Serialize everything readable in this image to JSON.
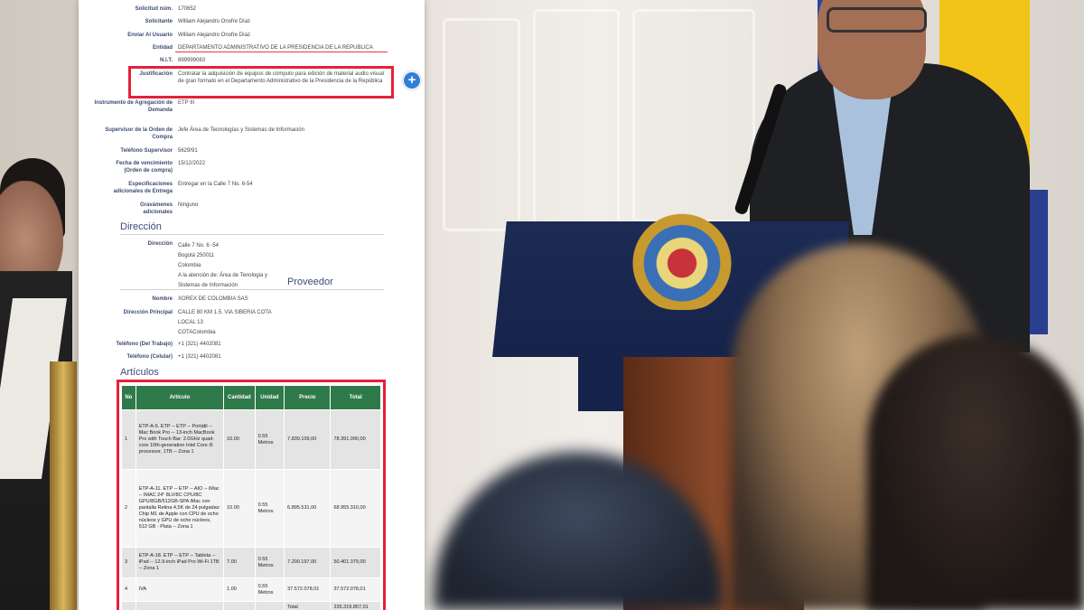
{
  "document": {
    "fields": [
      {
        "label": "Solicitud núm.",
        "value": "170652"
      },
      {
        "label": "Solicitante",
        "value": "William Alejandro Onofre Díaz"
      },
      {
        "label": "Enviar Al Usuario",
        "value": "William Alejandro Onofre Díaz"
      },
      {
        "label": "Entidad",
        "value": "DEPARTAMENTO ADMINISTRATIVO DE LA PRESIDENCIA DE LA REPUBLICA"
      },
      {
        "label": "N.I.T.",
        "value": "899999083"
      },
      {
        "label": "Justificación",
        "value": "Contratar la adquisición de equipos de cómputo para edición de material audio visual de gran formato en el Departamento Administrativo de la Presidencia de la República"
      },
      {
        "label": "Instrumento de Agregación de Demanda",
        "value": "ETP III"
      },
      {
        "label": "Supervisor de la Orden de Compra",
        "value": "Jefe Área de Tecnologías y Sistemas de Información"
      },
      {
        "label": "Teléfono Supervisor",
        "value": "5629/91"
      },
      {
        "label": "Fecha de vencimiento (Orden de compra)",
        "value": "15/12/2022"
      },
      {
        "label": "Especificaciones adicionales de Entrega",
        "value": "Entregar en la Calle 7 No. 6-54"
      },
      {
        "label": "Gravámenes adicionales",
        "value": "Ninguno"
      }
    ],
    "direccion_title": "Dirección",
    "direccion": {
      "label": "Dirección",
      "lines": [
        "Calle 7 No. 6 -54",
        "Bogotá 250011",
        "Colombia",
        "A la atención de: Área de Tenologia y",
        "Sistemas de Información"
      ]
    },
    "proveedor_title": "Proveedor",
    "proveedor": [
      {
        "label": "Nombre",
        "value": "XOREX DE COLOMBIA SAS"
      },
      {
        "label": "Dirección Principal",
        "value": "CALLE 80 KM 1.5. VIA SIBERIA COTA"
      },
      {
        "label": "",
        "value": "LOCAL 13"
      },
      {
        "label": "",
        "value": "COTAColombia"
      },
      {
        "label": "Teléfono (Del Trabajo)",
        "value": "+1 (321) 4402081"
      },
      {
        "label": "Teléfono (Celular)",
        "value": "+1 (321) 4402081"
      }
    ],
    "articulos_title": "Artículos",
    "table": {
      "headers": [
        "No",
        "Artículo",
        "Cantidad",
        "Unidad",
        "Precio",
        "Total"
      ],
      "rows": [
        {
          "no": "1",
          "articulo": "ETP-A-6. ETP -- ETP -- Portátil -- Mac Book Pro -- 13-inch MacBook Pro with Touch Bar: 2.0GHz quad-core 10th-generation Intel Core i5 processor, 1TB -- Zona 1",
          "cantidad": "10.00",
          "unidad": "0.55 Metros",
          "precio": "7.839.109,00",
          "total": "78.391.090,00"
        },
        {
          "no": "2",
          "articulo": "ETP-A-11. ETP -- ETP -- AIO -- iMac -- IMAC 24\" 8LV/8C CPU/8C GPU/8GB/512GB-SPA iMac con pantalla Retina 4,5K de 24 pulgadas: Chip M1 de Apple con CPU de ocho núcleos y GPU de ocho núcleos, 512 GB - Plata -- Zona 1",
          "cantidad": "10.00",
          "unidad": "0.55 Metros",
          "precio": "6.895.531,00",
          "total": "68.955.310,00"
        },
        {
          "no": "3",
          "articulo": "ETP-A-18. ETP -- ETP -- Tableta -- iPad -- 12.9-inch iPad Pro Wi-Fi 1TB -- Zona 1",
          "cantidad": "7.00",
          "unidad": "0.55 Metros",
          "precio": "7.200.197,00",
          "total": "50.401.379,00"
        },
        {
          "no": "4",
          "articulo": "IVA",
          "cantidad": "1.00",
          "unidad": "0.55 Metros",
          "precio": "37.572.078,01",
          "total": "37.572.078,01"
        }
      ],
      "total_label": "Total",
      "total_value": "235.319.857,01"
    },
    "plus_icon": "+"
  },
  "colors": {
    "highlight": "#e4213a",
    "table_header": "#2f7a4a",
    "label": "#3d4a74",
    "plus_button": "#2f7ed8"
  }
}
